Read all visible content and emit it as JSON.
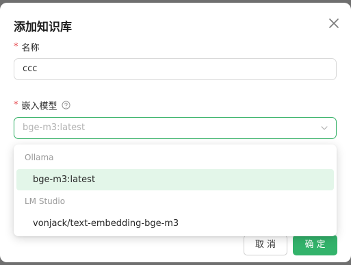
{
  "dialog": {
    "title": "添加知识库",
    "close_icon": "close-icon"
  },
  "form": {
    "required_mark": "*",
    "name_label": "名称",
    "name_value": "ccc",
    "model_label": "嵌入模型",
    "model_help_icon": "question-circle-icon",
    "model_placeholder": "bge-m3:latest",
    "chevron_icon": "chevron-down-icon"
  },
  "dropdown": {
    "groups": [
      {
        "label": "Ollama",
        "options": [
          {
            "label": "bge-m3:latest",
            "selected": true
          }
        ]
      },
      {
        "label": "LM Studio",
        "options": [
          {
            "label": "vonjack/text-embedding-bge-m3",
            "selected": false
          }
        ]
      }
    ]
  },
  "footer": {
    "cancel_label": "取 消",
    "ok_label": "确 定"
  },
  "colors": {
    "accent": "#33b36b",
    "selected_bg": "#e3f6e9",
    "required": "#e5484d"
  }
}
